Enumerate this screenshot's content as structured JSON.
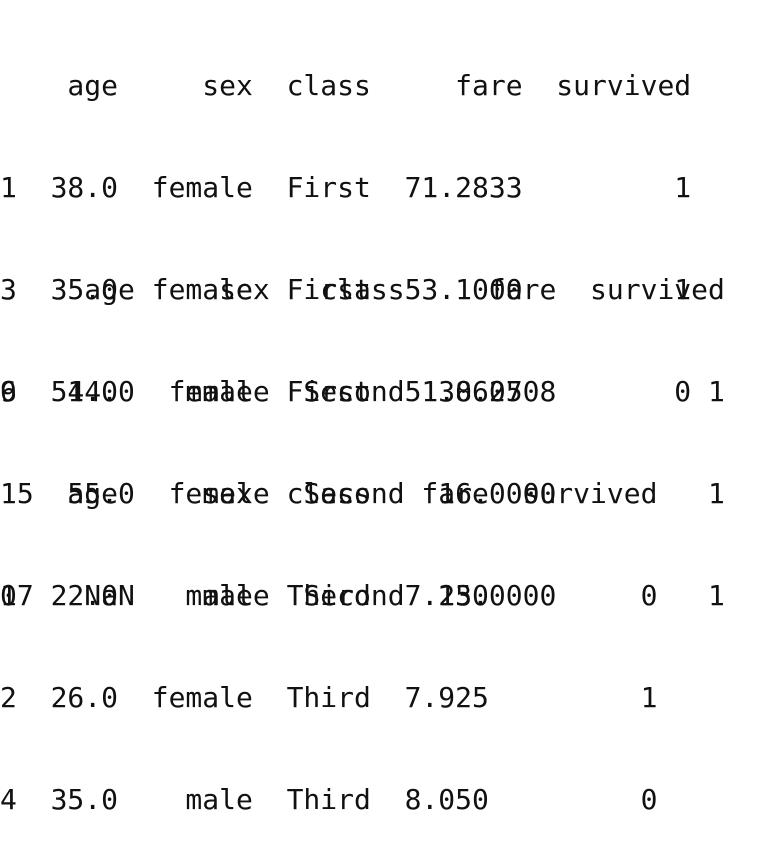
{
  "frames": [
    {
      "lines": [
        "    age     sex  class     fare  survived",
        "1  38.0  female  First  71.2833         1",
        "3  35.0  female  First  53.1000         1",
        "6  54.0    male  First  51.8625         0"
      ]
    },
    {
      "lines": [
        "     age     sex   class     fare  survived",
        "9   14.0  female  Second  30.0708         1",
        "15  55.0  female  Second  16.0000         1",
        "17   NaN    male  Second  13.0000         1"
      ]
    },
    {
      "lines": [
        "    age     sex  class   fare  survived",
        "0  22.0    male  Third  7.250         0",
        "2  26.0  female  Third  7.925         1",
        "4  35.0    male  Third  8.050         0"
      ]
    }
  ]
}
